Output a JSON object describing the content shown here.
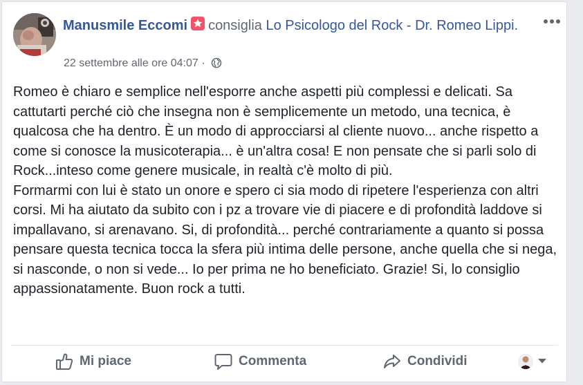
{
  "post": {
    "author": "Manusmile Eccomi",
    "verb": "consiglia",
    "page_name": "Lo Psicologo del Rock - Dr. Romeo Lippi",
    "period": ".",
    "timestamp": "22 settembre alle ore 04:07",
    "separator": "·",
    "privacy_icon": "globe-icon",
    "more_icon": "more-options-icon",
    "paragraphs": [
      "Romeo è chiaro e semplice nell'esporre anche aspetti più complessi e delicati. Sa cattutarti perché ciò che insegna non è semplicemente un metodo, una tecnica, è qualcosa che ha dentro. È un modo di approcciarsi al cliente nuovo... anche rispetto a come si conosce la musicoterapia... è un'altra cosa! E non pensate che si parli solo di Rock...inteso come genere musicale, in realtà c'è molto di più.",
      "Formarmi con lui è stato un onore e spero ci sia modo di ripetere l'esperienza con altri corsi. Mi ha aiutato da subito con i pz a trovare vie di piacere e di profondità laddove si impallavano, si arenavano. Si, di profondità... perché contrariamente a quanto si possa pensare questa tecnica tocca la sfera più intima delle persone, anche quella che si nega, si nasconde, o non si vede... Io per prima ne ho beneficiato. Grazie! Si, lo consiglio appassionatamente. Buon rock a tutti."
    ]
  },
  "actions": {
    "like_label": "Mi piace",
    "comment_label": "Commenta",
    "share_label": "Condividi"
  },
  "colors": {
    "link": "#365899",
    "badge": "#f35369",
    "text": "#1d2129",
    "muted": "#616770"
  }
}
